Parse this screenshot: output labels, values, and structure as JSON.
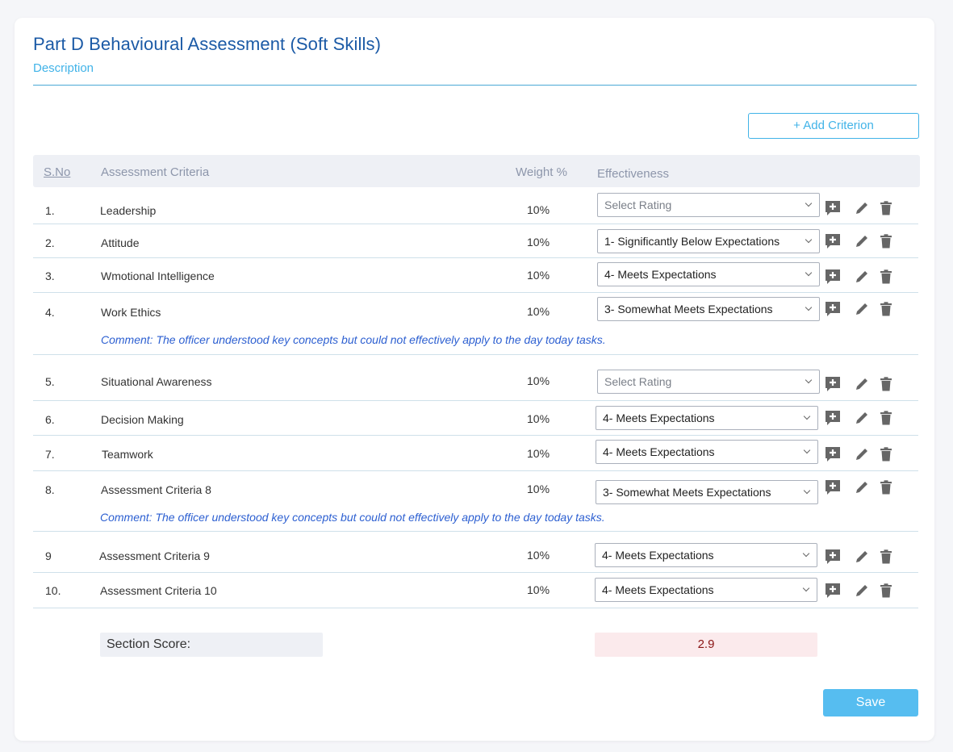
{
  "section": {
    "title": "Part D Behavioural Assessment (Soft Skills)",
    "description": "Description"
  },
  "toolbar": {
    "add_label": "+ Add Criterion"
  },
  "table": {
    "headers": {
      "sno": "S.No",
      "criteria": "Assessment Criteria",
      "weight": "Weight %",
      "effectiveness": "Effectiveness"
    },
    "rows": [
      {
        "sno": "1.",
        "criteria": "Leadership",
        "weight": "10%",
        "rating": "Select Rating",
        "placeholder": true,
        "comment": ""
      },
      {
        "sno": "2.",
        "criteria": "Attitude",
        "weight": "10%",
        "rating": "1- Significantly Below Expectations",
        "placeholder": false,
        "comment": ""
      },
      {
        "sno": "3.",
        "criteria": "Wmotional Intelligence",
        "weight": "10%",
        "rating": "4- Meets Expectations",
        "placeholder": false,
        "comment": ""
      },
      {
        "sno": "4.",
        "criteria": "Work Ethics",
        "weight": "10%",
        "rating": "3- Somewhat Meets Expectations",
        "placeholder": false,
        "comment": "Comment: The officer understood key concepts but could not effectively apply to the day today tasks."
      },
      {
        "sno": "5.",
        "criteria": "Situational Awareness",
        "weight": "10%",
        "rating": "Select Rating",
        "placeholder": true,
        "comment": ""
      },
      {
        "sno": "6.",
        "criteria": "Decision Making",
        "weight": "10%",
        "rating": "4- Meets Expectations",
        "placeholder": false,
        "comment": ""
      },
      {
        "sno": "7.",
        "criteria": "Teamwork",
        "weight": "10%",
        "rating": "4- Meets Expectations",
        "placeholder": false,
        "comment": ""
      },
      {
        "sno": "8.",
        "criteria": "Assessment Criteria 8",
        "weight": "10%",
        "rating": "3- Somewhat Meets Expectations",
        "placeholder": false,
        "comment": "Comment: The officer understood key concepts but could not effectively apply to the day today tasks."
      },
      {
        "sno": "9",
        "criteria": "Assessment Criteria 9",
        "weight": "10%",
        "rating": "4- Meets Expectations",
        "placeholder": false,
        "comment": ""
      },
      {
        "sno": "10.",
        "criteria": "Assessment Criteria 10",
        "weight": "10%",
        "rating": "4- Meets Expectations",
        "placeholder": false,
        "comment": ""
      }
    ]
  },
  "score": {
    "label": "Section Score:",
    "value": "2.9"
  },
  "footer": {
    "save_label": "Save"
  },
  "icons": [
    "add-comment-icon",
    "pencil-icon",
    "trash-icon"
  ],
  "colors": {
    "title": "#1b5aa6",
    "accent": "#41b3e8",
    "comment": "#2c5fd1",
    "score_text": "#8a1515",
    "score_bg": "#fbeaec",
    "save_bg": "#56bdf0"
  }
}
